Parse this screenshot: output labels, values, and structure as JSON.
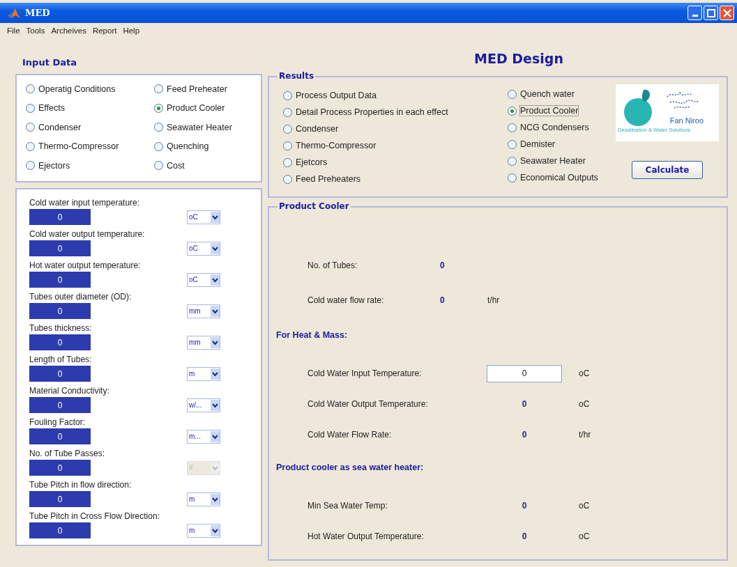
{
  "window": {
    "title": "MED"
  },
  "menu": [
    "File",
    "Tools",
    "Archeives",
    "Report",
    "Help"
  ],
  "input_data": {
    "title": "Input Data",
    "options": [
      {
        "label": "Operatig Conditions",
        "selected": false
      },
      {
        "label": "Effects",
        "selected": false
      },
      {
        "label": "Condenser",
        "selected": false
      },
      {
        "label": "Thermo-Compressor",
        "selected": false
      },
      {
        "label": "Ejectors",
        "selected": false
      },
      {
        "label": "Feed Preheater",
        "selected": false
      },
      {
        "label": "Product Cooler",
        "selected": true
      },
      {
        "label": "Seawater Heater",
        "selected": false
      },
      {
        "label": "Quenching",
        "selected": false
      },
      {
        "label": "Cost",
        "selected": false
      }
    ]
  },
  "parameters": [
    {
      "label": "Cold water input temperature:",
      "value": "0",
      "unit": "oC",
      "disabled": false
    },
    {
      "label": "Cold water output temperature:",
      "value": "0",
      "unit": "oC",
      "disabled": false
    },
    {
      "label": "Hot water output temperature:",
      "value": "0",
      "unit": "oC",
      "disabled": false
    },
    {
      "label": "Tubes outer diameter (OD):",
      "value": "0",
      "unit": "mm",
      "disabled": false
    },
    {
      "label": "Tubes thickness:",
      "value": "0",
      "unit": "mm",
      "disabled": false
    },
    {
      "label": "Length of Tubes:",
      "value": "0",
      "unit": "m",
      "disabled": false
    },
    {
      "label": "Material Conductivity:",
      "value": "0",
      "unit": "w/...",
      "disabled": false
    },
    {
      "label": "Fouling Factor:",
      "value": "0",
      "unit": "m...",
      "disabled": false
    },
    {
      "label": "No. of Tube Passes:",
      "value": "0",
      "unit": "#",
      "disabled": true
    },
    {
      "label": "Tube Pitch in flow direction:",
      "value": "0",
      "unit": "m",
      "disabled": false
    },
    {
      "label": "Tube Pitch in Cross Flow Direction:",
      "value": "0",
      "unit": "m",
      "disabled": false
    }
  ],
  "design_title": "MED Design",
  "results": {
    "title": "Results",
    "options": [
      {
        "label": "Process Output Data",
        "selected": false
      },
      {
        "label": "Detail Process Properties in each effect",
        "selected": false
      },
      {
        "label": "Condenser",
        "selected": false
      },
      {
        "label": "Thermo-Compressor",
        "selected": false
      },
      {
        "label": "Ejetcors",
        "selected": false
      },
      {
        "label": "Feed Preheaters",
        "selected": false
      },
      {
        "label": "Quench water",
        "selected": false
      },
      {
        "label": "Product Cooler",
        "selected": true
      },
      {
        "label": "NCG Condensers",
        "selected": false
      },
      {
        "label": "Demister",
        "selected": false
      },
      {
        "label": "Seawater Heater",
        "selected": false
      },
      {
        "label": "Economical Outputs",
        "selected": false
      }
    ]
  },
  "logo": {
    "name": "Fan Niroo",
    "tagline": "Desalination & Water Solutions"
  },
  "calculate_button": "Calculate",
  "product_cooler": {
    "title": "Product Cooler",
    "sections": [
      {
        "rows": [
          {
            "kind": "output",
            "label": "No. of Tubes:",
            "value": "0"
          },
          {
            "kind": "output",
            "label": "Cold water flow rate:",
            "value": "0",
            "unit": "t/hr"
          }
        ]
      },
      {
        "heading": "For Heat & Mass:",
        "rows": [
          {
            "kind": "input",
            "label": "Cold Water Input Temperature:",
            "value": "0",
            "unit": "oC"
          },
          {
            "kind": "output",
            "label": "Cold Water Output Temperature:",
            "value": "0",
            "unit": "oC"
          },
          {
            "kind": "output",
            "label": "Cold Water Flow Rate:",
            "value": "0",
            "unit": "t/hr"
          }
        ]
      },
      {
        "heading": "Product cooler as sea water heater:",
        "rows": [
          {
            "kind": "output",
            "label": "Min Sea Water Temp:",
            "value": "0",
            "unit": "oC"
          },
          {
            "kind": "output",
            "label": "Hot Water Output Temperature:",
            "value": "0",
            "unit": "oC"
          }
        ]
      }
    ]
  }
}
